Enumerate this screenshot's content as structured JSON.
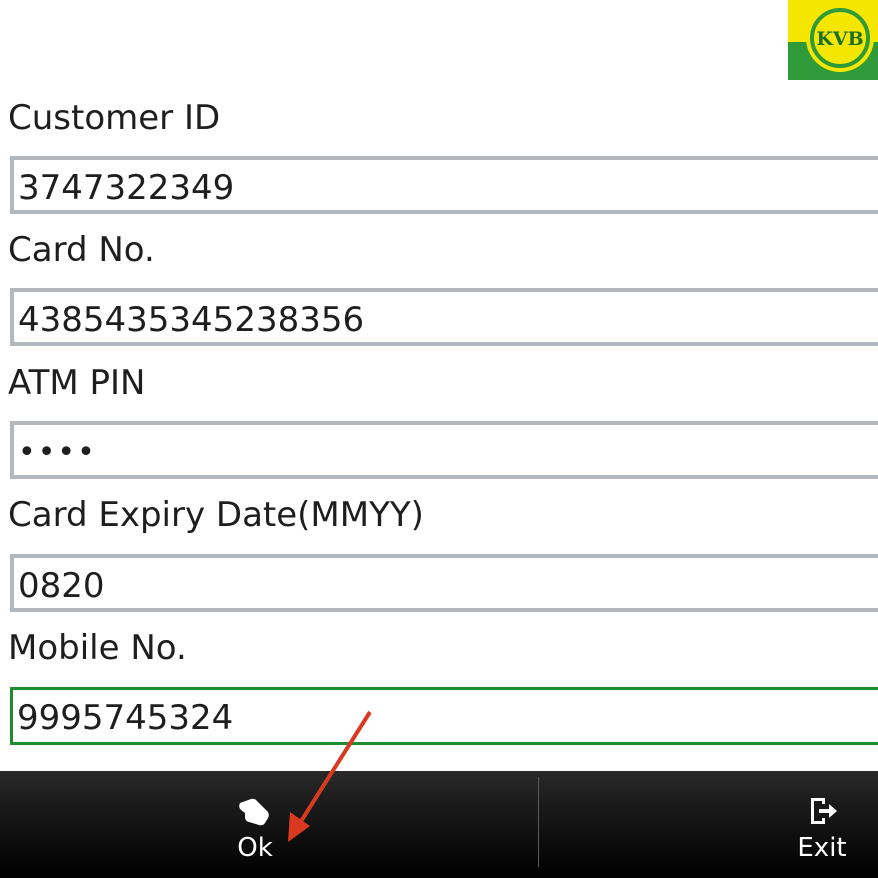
{
  "app": {
    "logo_text": "KVB",
    "colors": {
      "logo_green": "#2e9a3a",
      "logo_yellow": "#f5e600",
      "active_border": "#1f8a2e",
      "field_border": "#b3b8bd",
      "arrow_red": "#d93a1f"
    }
  },
  "form": {
    "customer_id": {
      "label": "Customer ID",
      "value": "3747322349"
    },
    "card_no": {
      "label": "Card No.",
      "value": "4385435345238356"
    },
    "atm_pin": {
      "label": "ATM PIN",
      "value": "••••"
    },
    "card_expiry": {
      "label": "Card Expiry Date(MMYY)",
      "value": "0820"
    },
    "mobile_no": {
      "label": "Mobile No.",
      "value": "9995745324"
    }
  },
  "bottom_bar": {
    "ok": {
      "label": "Ok",
      "icon": "hand-pointer-icon"
    },
    "exit": {
      "label": "Exit",
      "icon": "exit-icon"
    }
  }
}
